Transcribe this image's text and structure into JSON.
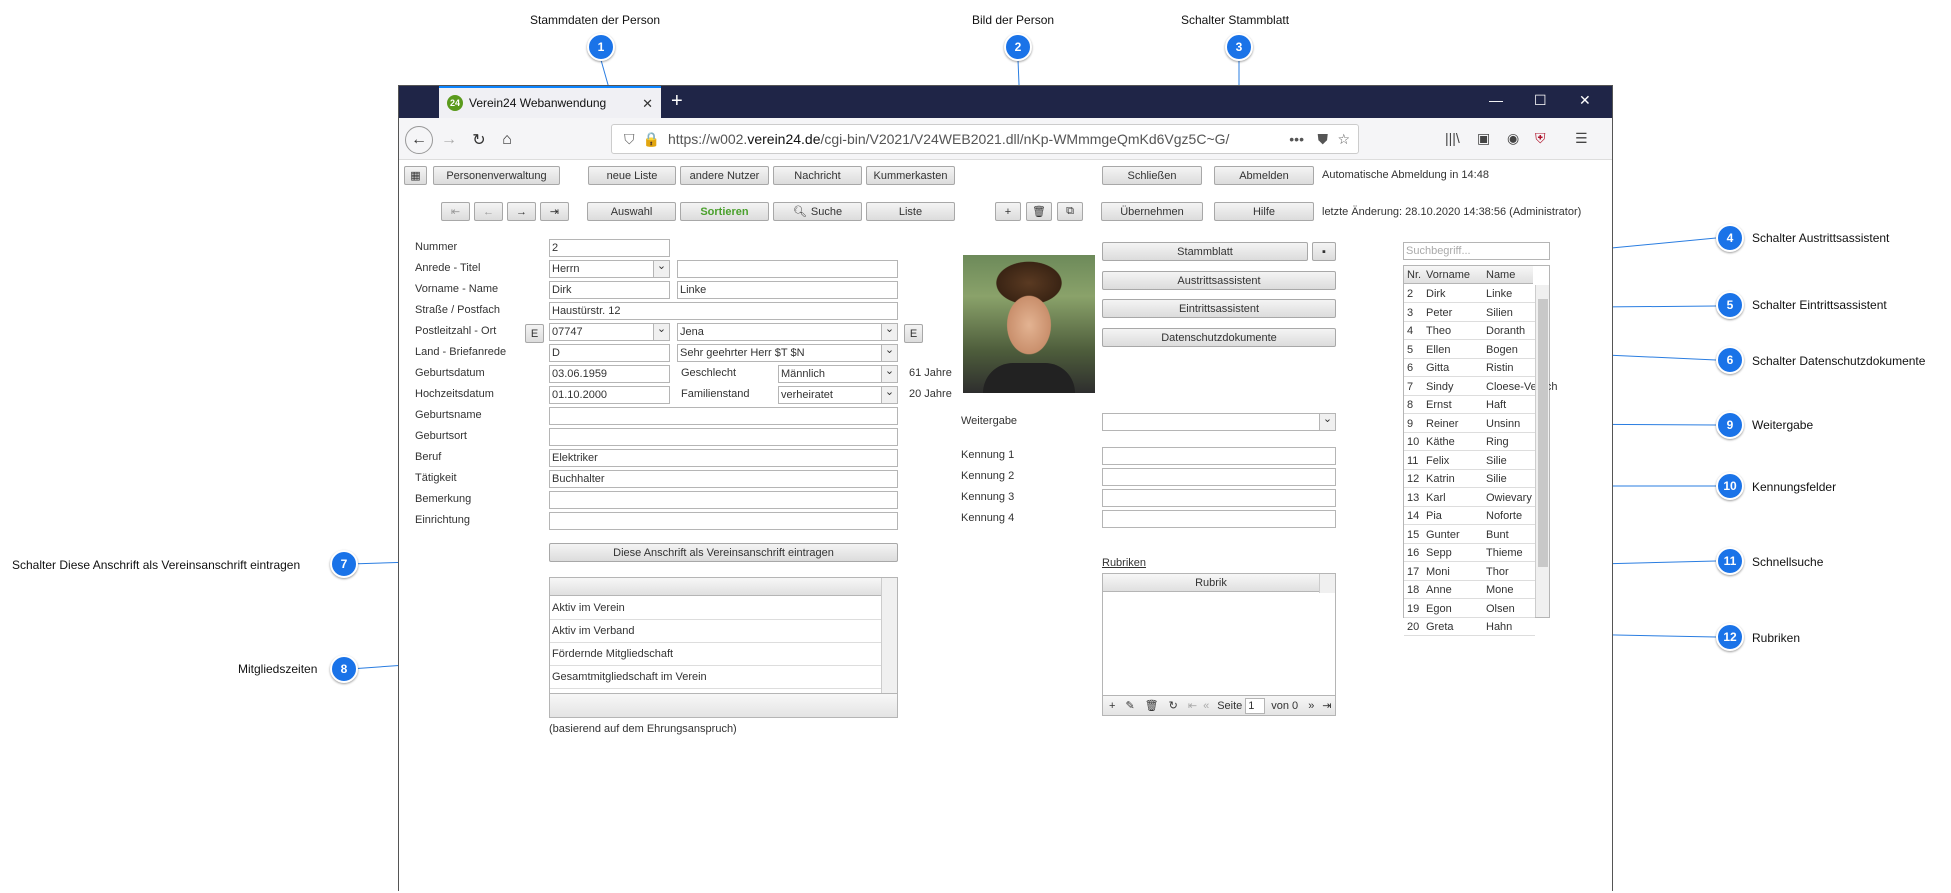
{
  "callouts": [
    {
      "num": "1",
      "label": "Stammdaten der Person"
    },
    {
      "num": "2",
      "label": "Bild der Person"
    },
    {
      "num": "3",
      "label": "Schalter Stammblatt"
    },
    {
      "num": "4",
      "label": "Schalter Austrittsassistent"
    },
    {
      "num": "5",
      "label": "Schalter Eintrittsassistent"
    },
    {
      "num": "6",
      "label": "Schalter Datenschutzdokumente"
    },
    {
      "num": "7",
      "label": "Schalter Diese Anschrift als Vereinsanschrift eintragen"
    },
    {
      "num": "8",
      "label": "Mitgliedszeiten"
    },
    {
      "num": "9",
      "label": "Weitergabe"
    },
    {
      "num": "10",
      "label": "Kennungsfelder"
    },
    {
      "num": "11",
      "label": "Schnellsuche"
    },
    {
      "num": "12",
      "label": "Rubriken"
    }
  ],
  "browser": {
    "tab_title": "Verein24 Webanwendung",
    "tab_favicon": "24",
    "url_prefix": "https://w002.",
    "url_domain": "verein24.de",
    "url_path": "/cgi-bin/V2021/V24WEB2021.dll/nKp-WMmmgeQmKd6Vgz5C~G/",
    "url_more": "•••"
  },
  "toolbar1": {
    "personenverwaltung": "Personenverwaltung",
    "neue_liste": "neue Liste",
    "andere_nutzer": "andere Nutzer",
    "nachricht": "Nachricht",
    "kummerkasten": "Kummerkasten",
    "schliessen": "Schließen",
    "abmelden": "Abmelden",
    "auto_logout": "Automatische Abmeldung in 14:48"
  },
  "toolbar2": {
    "auswahl": "Auswahl",
    "sortieren": "Sortieren",
    "suche": "Suche",
    "liste": "Liste",
    "uebernehmen": "Übernehmen",
    "hilfe": "Hilfe",
    "last_change": "letzte Änderung: 28.10.2020 14:38:56 (Administrator)"
  },
  "form": {
    "nummer_label": "Nummer",
    "nummer": "2",
    "anrede_label": "Anrede - Titel",
    "anrede": "Herrn",
    "titel": "",
    "vorname_label": "Vorname - Name",
    "vorname": "Dirk",
    "name": "Linke",
    "strasse_label": "Straße / Postfach",
    "strasse": "Haustürstr. 12",
    "plz_label": "Postleitzahl - Ort",
    "plz": "07747",
    "ort": "Jena",
    "e_button": "E",
    "land_label": "Land - Briefanrede",
    "land": "D",
    "briefanrede": "Sehr geehrter Herr $T $N",
    "geburtsdatum_label": "Geburtsdatum",
    "geburtsdatum": "03.06.1959",
    "geschlecht_label": "Geschlecht",
    "geschlecht": "Männlich",
    "alter": "61 Jahre",
    "hochzeit_label": "Hochzeitsdatum",
    "hochzeit": "01.10.2000",
    "familienstand_label": "Familienstand",
    "familienstand": "verheiratet",
    "ehejahre": "20 Jahre",
    "geburtsname_label": "Geburtsname",
    "geburtsname": "",
    "geburtsort_label": "Geburtsort",
    "geburtsort": "",
    "beruf_label": "Beruf",
    "beruf": "Elektriker",
    "taetigkeit_label": "Tätigkeit",
    "taetigkeit": "Buchhalter",
    "bemerkung_label": "Bemerkung",
    "bemerkung": "",
    "einrichtung_label": "Einrichtung",
    "einrichtung": "",
    "vereinsanschrift_button": "Diese Anschrift als Vereinsanschrift eintragen",
    "mitgliedszeiten": [
      "Aktiv im Verein",
      "Aktiv im Verband",
      "Fördernde Mitgliedschaft",
      "Gesamtmitgliedschaft im Verein"
    ],
    "ehrung_note": "(basierend auf dem Ehrungsanspruch)"
  },
  "right": {
    "stammblatt": "Stammblatt",
    "austritt": "Austrittsassistent",
    "eintritt": "Eintrittsassistent",
    "datenschutz": "Datenschutzdokumente",
    "weitergabe_label": "Weitergabe",
    "kennung_labels": [
      "Kennung 1",
      "Kennung 2",
      "Kennung 3",
      "Kennung 4"
    ],
    "rubriken_link": "Rubriken",
    "rubrik_header": "Rubrik",
    "seite_label": "Seite",
    "seite_value": "1",
    "von_label": "von 0",
    "search_placeholder": "Suchbegriff..."
  },
  "quicklist": {
    "headers": [
      "Nr.",
      "Vorname",
      "Name"
    ],
    "rows": [
      [
        "2",
        "Dirk",
        "Linke"
      ],
      [
        "3",
        "Peter",
        "Silien"
      ],
      [
        "4",
        "Theo",
        "Doranth"
      ],
      [
        "5",
        "Ellen",
        "Bogen"
      ],
      [
        "6",
        "Gitta",
        "Ristin"
      ],
      [
        "7",
        "Sindy",
        "Cloese-Vertich"
      ],
      [
        "8",
        "Ernst",
        "Haft"
      ],
      [
        "9",
        "Reiner",
        "Unsinn"
      ],
      [
        "10",
        "Käthe",
        "Ring"
      ],
      [
        "11",
        "Felix",
        "Silie"
      ],
      [
        "12",
        "Katrin",
        "Silie"
      ],
      [
        "13",
        "Karl",
        "Owievary"
      ],
      [
        "14",
        "Pia",
        "Noforte"
      ],
      [
        "15",
        "Gunter",
        "Bunt"
      ],
      [
        "16",
        "Sepp",
        "Thieme"
      ],
      [
        "17",
        "Moni",
        "Thor"
      ],
      [
        "18",
        "Anne",
        "Mone"
      ],
      [
        "19",
        "Egon",
        "Olsen"
      ],
      [
        "20",
        "Greta",
        "Hahn"
      ]
    ]
  }
}
